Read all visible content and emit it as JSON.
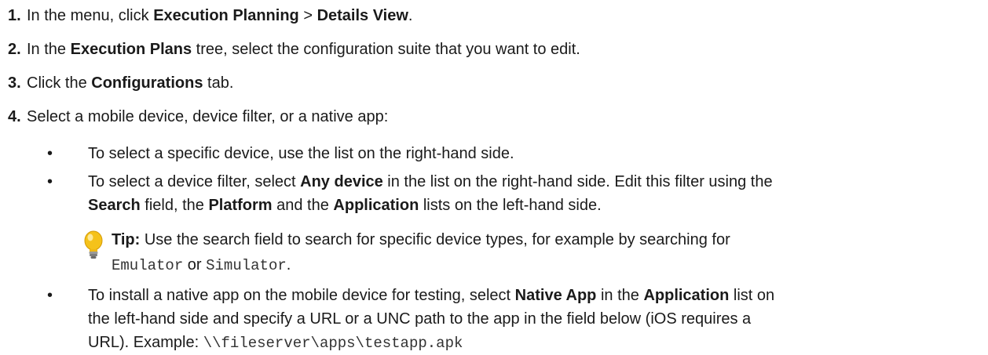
{
  "steps": [
    {
      "num": "1.",
      "t1": "In the menu, click ",
      "b1": "Execution Planning",
      "t2": " > ",
      "b2": "Details View",
      "t3": "."
    },
    {
      "num": "2.",
      "t1": "In the ",
      "b1": "Execution Plans",
      "t2": " tree, select the configuration suite that you want to edit."
    },
    {
      "num": "3.",
      "t1": "Click the ",
      "b1": "Configurations",
      "t2": " tab."
    },
    {
      "num": "4.",
      "t1": "Select a mobile device, device filter, or a native app:"
    }
  ],
  "bullets": [
    {
      "marker": "•",
      "text": "To select a specific device, use the list on the right-hand side."
    },
    {
      "marker": "•",
      "t1": "To select a device filter, select ",
      "b1": "Any device",
      "t2": " in the list on the right-hand side. Edit this filter using the",
      "b2": "Search",
      "t3": " field, the ",
      "b3": "Platform",
      "t4": " and the ",
      "b4": "Application",
      "t5": " lists on the left-hand side."
    },
    {
      "marker": "•",
      "t1": "To install a native app on the mobile device for testing, select ",
      "b1": "Native App",
      "t2": " in the ",
      "b2": "Application",
      "t3": " list on",
      "line2": "the left-hand side and specify a URL or a UNC path to the app in the field below (iOS requires a",
      "line3a": "URL). Example: ",
      "code": "\\\\fileserver\\apps\\testapp.apk"
    }
  ],
  "tip": {
    "label": "Tip:",
    "t1": " Use the search field to search for specific device types, for example by searching for",
    "code1": "Emulator",
    "t2": " or ",
    "code2": "Simulator",
    "t3": "."
  },
  "colors": {
    "text": "#1a1a1a",
    "bulb_yellow": "#f5c21a",
    "bulb_base": "#8a8a8a"
  }
}
